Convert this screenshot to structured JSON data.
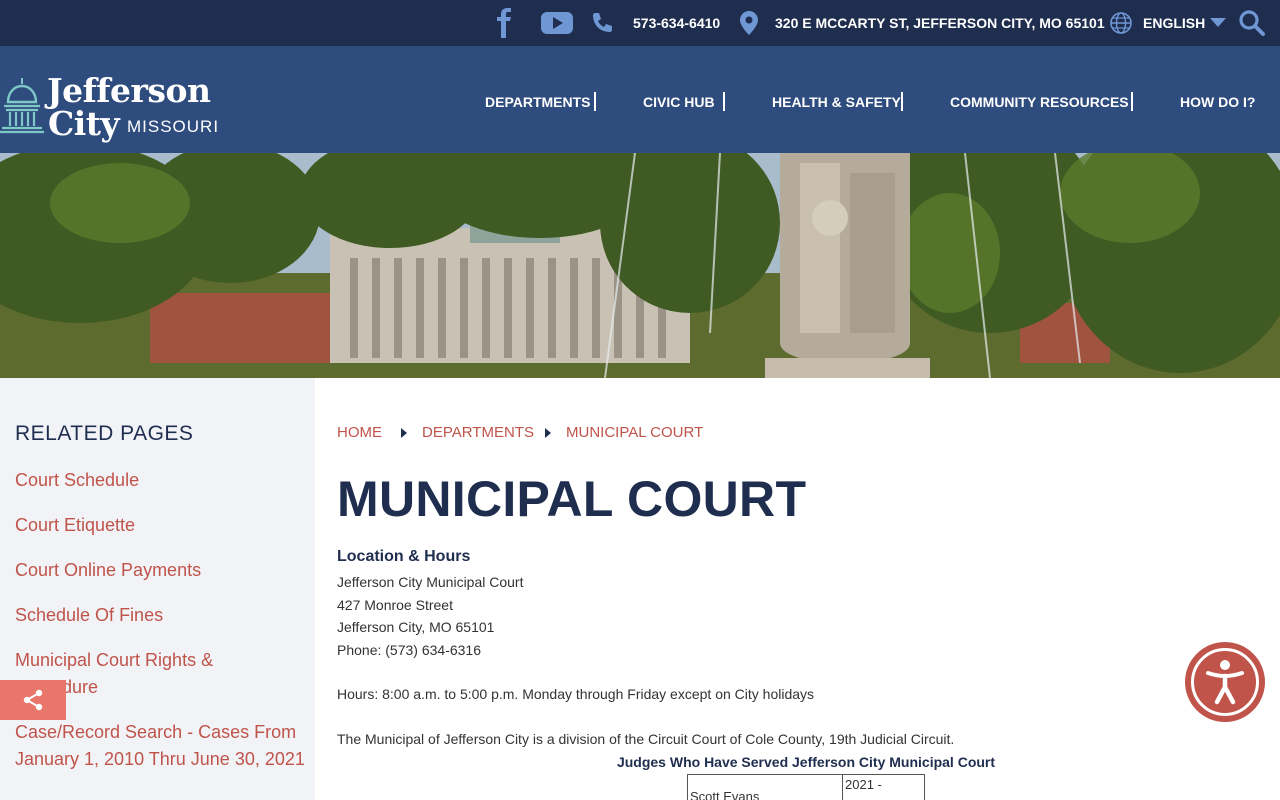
{
  "topbar": {
    "phone": "573-634-6410",
    "address": "320 E MCCARTY ST, JEFFERSON CITY, MO 65101",
    "language": "ENGLISH",
    "icons": [
      "facebook-icon",
      "youtube-icon",
      "phone-icon",
      "location-icon",
      "globe-icon",
      "search-icon"
    ]
  },
  "logo": {
    "line1": "Jefferson",
    "line2": "City",
    "line3": "MISSOURI"
  },
  "nav": [
    "DEPARTMENTS",
    "CIVIC HUB",
    "HEALTH & SAFETY",
    "COMMUNITY RESOURCES",
    "HOW DO I?"
  ],
  "sidebar": {
    "heading": "RELATED PAGES",
    "links": [
      "Court Schedule",
      "Court Etiquette",
      "Court Online Payments",
      "Schedule Of Fines",
      "Municipal Court Rights & Procedure",
      "Case/Record Search - Cases From January 1, 2010 Thru June 30, 2021"
    ]
  },
  "breadcrumb": [
    "HOME",
    "DEPARTMENTS",
    "MUNICIPAL COURT"
  ],
  "page": {
    "title": "MUNICIPAL COURT",
    "section": "Location & Hours",
    "address_lines": [
      "Jefferson City Municipal Court",
      "427 Monroe Street",
      "Jefferson City, MO  65101",
      "Phone: (573) 634-6316"
    ],
    "hours": "Hours: 8:00 a.m. to 5:00 p.m. Monday through Friday except on City holidays",
    "division": "The Municipal of Jefferson City is a division of the Circuit Court of Cole County, 19th Judicial Circuit.",
    "table_title": "Judges Who Have Served Jefferson City Municipal Court",
    "judges": [
      {
        "name": "Scott Evans",
        "years": "2021 -"
      }
    ]
  },
  "colors": {
    "navy": "#1f2d4f",
    "nav_blue": "#2f4c7e",
    "accent": "#c0544a",
    "sidebar_bg": "#f1f3f7"
  }
}
